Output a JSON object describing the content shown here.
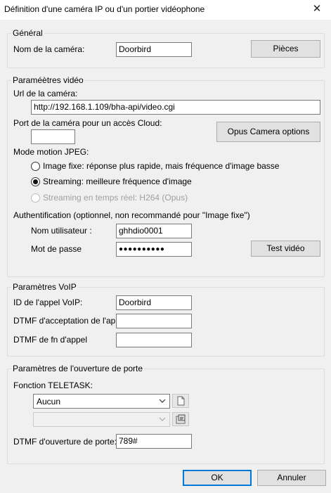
{
  "window": {
    "title": "Définition d'une caméra IP ou d'un portier vidéophone",
    "close_glyph": "✕"
  },
  "general": {
    "legend": "Général",
    "name_label": "Nom de la caméra:",
    "name_value": "Doorbird",
    "parts_button": "Pièces"
  },
  "video": {
    "legend": "Paraméètres vidéo",
    "url_label": "Url de la caméra:",
    "url_value": "http://192.168.1.109/bha-api/video.cgi",
    "cloud_port_label": "Port de la caméra pour un accès Cloud:",
    "cloud_port_value": "",
    "opus_button": "Opus Camera options",
    "mjpeg_label": "Mode motion JPEG:",
    "radio_fixed": "Image fixe: réponse plus rapide, mais fréquence d'image basse",
    "radio_streaming": "Streaming: meilleure fréquence d'image",
    "radio_realtime": "Streaming en temps réel: H264 (Opus)",
    "selected_mode": "streaming",
    "auth_label": "Authentification (optionnel, non recommandé pour \"Image fixe\")",
    "user_label": "Nom utilisateur :",
    "user_value": "ghhdio0001",
    "password_label": "Mot de passe",
    "password_value": "●●●●●●●●●●",
    "test_button": "Test vidéo"
  },
  "voip": {
    "legend": "Paramètres VoIP",
    "call_id_label": "ID de l'appel VoIP:",
    "call_id_value": "Doorbird",
    "accept_label": "DTMF d'acceptation de l'appe",
    "accept_value": "",
    "end_label": "DTMF de fn d'appel",
    "end_value": ""
  },
  "door": {
    "legend": "Paramètres de l'ouverture de porte",
    "function_label": "Fonction TELETASK:",
    "function_value": "Aucun",
    "second_select_value": "",
    "dtmf_label": "DTMF d'ouverture de porte:",
    "dtmf_value": "789#"
  },
  "footer": {
    "ok_button": "OK",
    "cancel_button": "Annuler"
  },
  "icons": {
    "page": "page-icon",
    "config": "config-icon",
    "chevron": "chevron-down-icon"
  }
}
